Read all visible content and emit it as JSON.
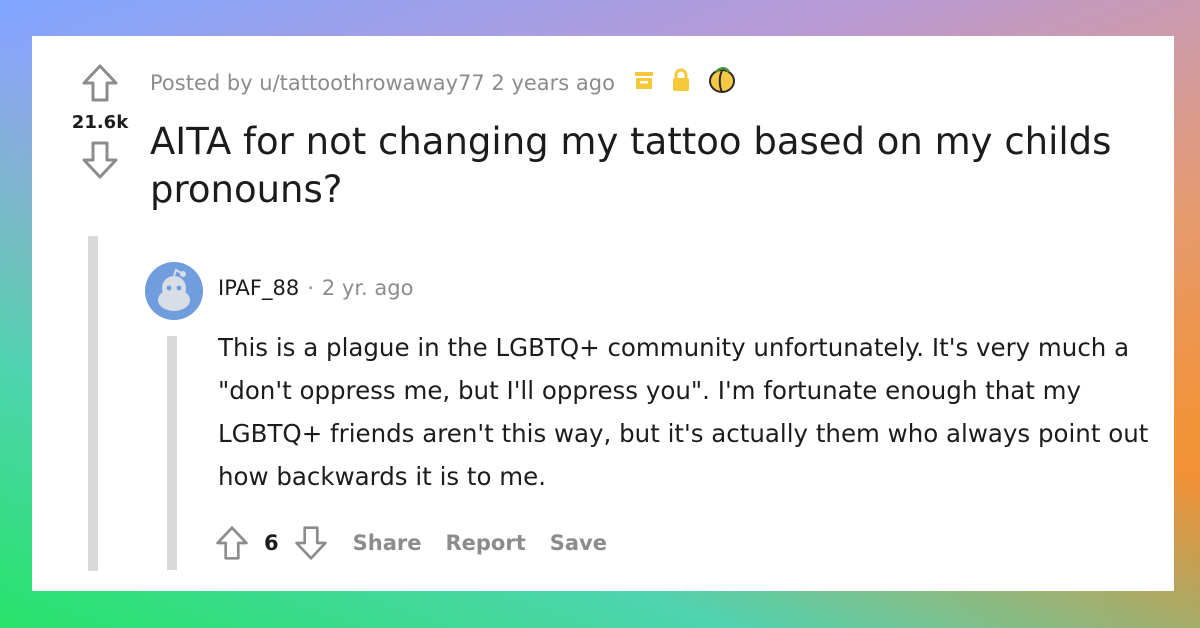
{
  "post": {
    "score": "21.6k",
    "meta": "Posted by u/tattoothrowaway77 2 years ago",
    "title": "AITA for not changing my tattoo based on my childs pronouns?"
  },
  "comment": {
    "author": "IPAF_88",
    "separator": "·",
    "time": "2 yr. ago",
    "body": "This is a plague in the LGBTQ+ community unfortunately. It's very much a \"don't oppress me, but I'll oppress you\". I'm fortunate enough that my LGBTQ+ friends aren't this way, but it's actually them who always point out how backwards it is to me.",
    "score": "6",
    "actions": {
      "share": "Share",
      "report": "Report",
      "save": "Save"
    }
  },
  "icons": [
    "upvote-icon",
    "downvote-icon",
    "archive-icon",
    "lock-icon",
    "award-icon",
    "reddit-avatar"
  ],
  "colors": {
    "card": "#ffffff",
    "text": "#1c1c1c",
    "muted": "#8a8c8e",
    "flair_yellow": "#f5c93a",
    "avatar": "#6f9dde"
  }
}
